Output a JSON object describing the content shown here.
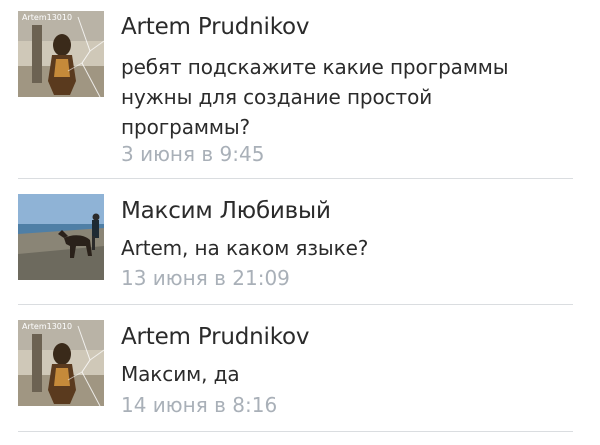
{
  "comments": [
    {
      "author": "Artem Prudnikov",
      "avatar_caption": "Artem13010",
      "text_lines": [
        "ребят подскажите какие программы",
        "нужны для создание простой",
        "программы?"
      ],
      "date": "3 июня в 9:45"
    },
    {
      "author": "Максим Любивый",
      "text_lines": [
        "Artem, на каком языке?"
      ],
      "date": "13 июня в 21:09"
    },
    {
      "author": "Artem Prudnikov",
      "avatar_caption": "Artem13010",
      "text_lines": [
        "Максим, да"
      ],
      "date": "14 июня в 8:16"
    }
  ],
  "colors": {
    "name_text": "#2b2b2b",
    "date_text": "#a9b0b8",
    "divider": "#dadde0",
    "background": "#ffffff"
  }
}
